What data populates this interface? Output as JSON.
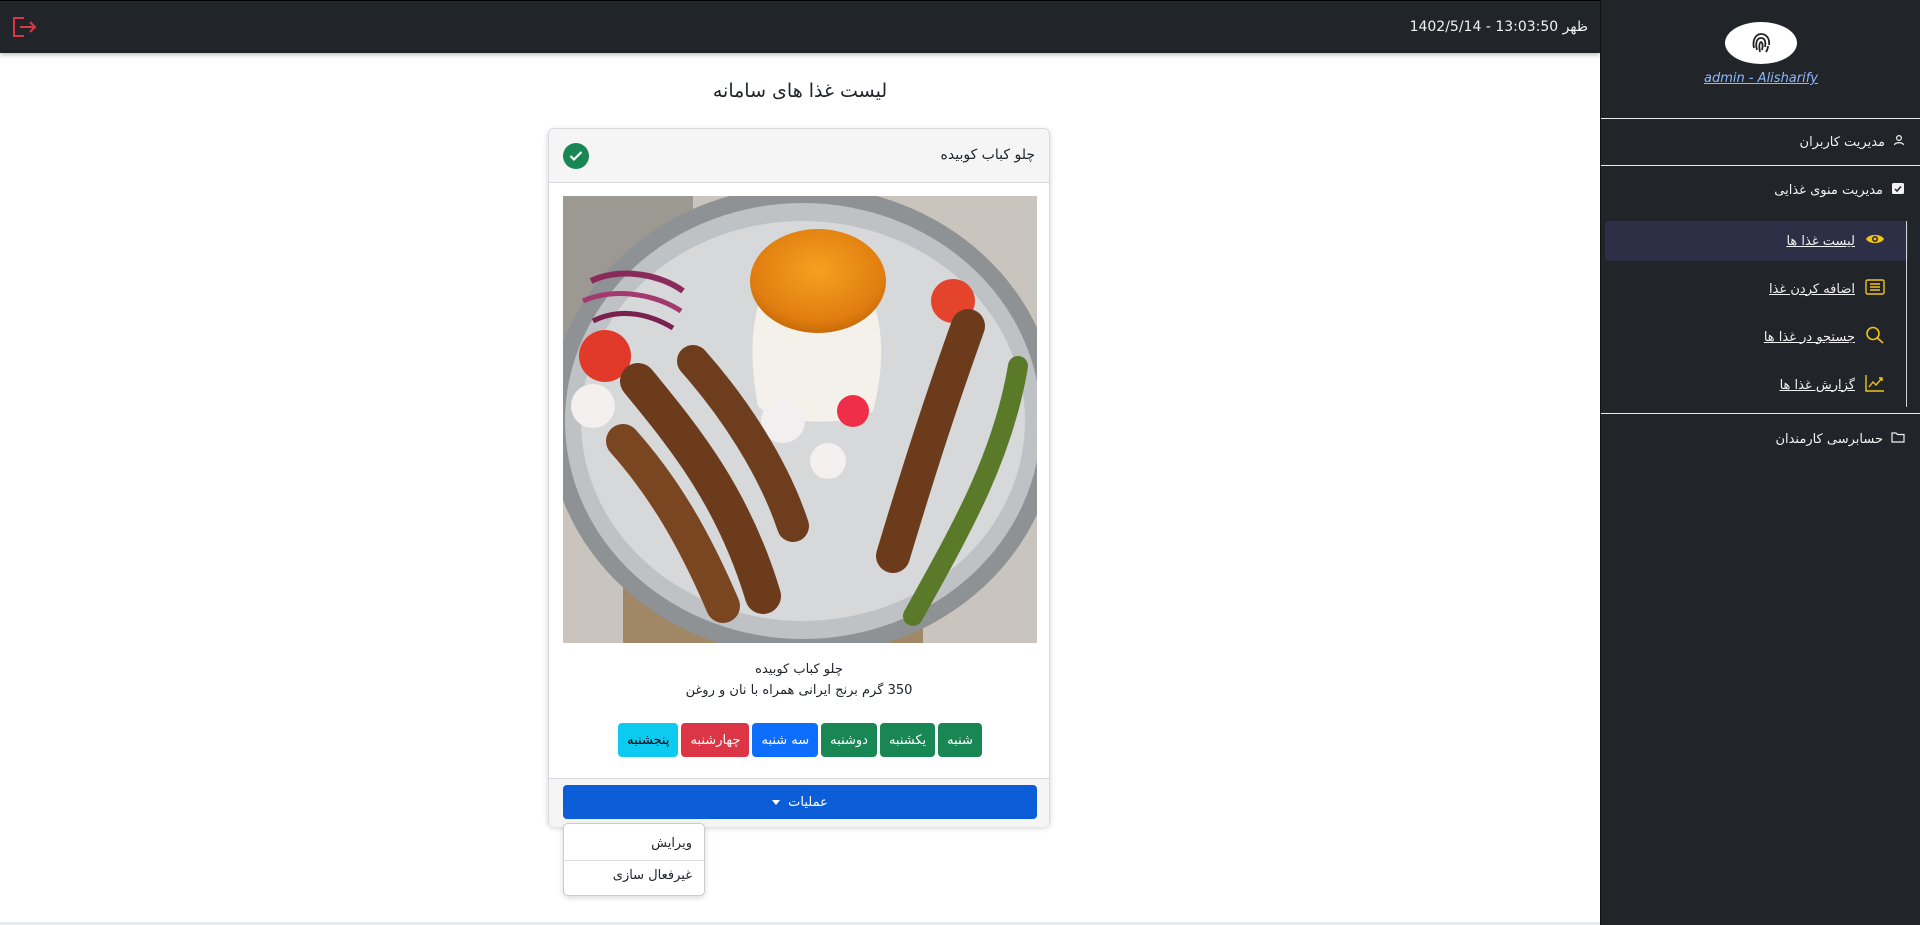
{
  "topbar": {
    "datetime": "ظهر 13:03:50 - 1402/5/14",
    "logout_color": "#dc3545"
  },
  "sidebar": {
    "username": "admin - Alisharify",
    "menu": {
      "users": "مدیریت کاربران",
      "food_menu": "مدیریت منوی غذایی",
      "employees": "حسابرسی کارمندان"
    },
    "submenu": {
      "list": "لیست غذا ها",
      "add": "اضافه کردن غذا",
      "search": "جستجو در غذا ها",
      "report": "گزارش غذا ها"
    },
    "accent": "#f0c419"
  },
  "main": {
    "page_title": "لیست غذا های سامانه",
    "card": {
      "header_title": "چلو کباب کوبیده",
      "food_name": "چلو کباب کوبیده",
      "description": "350 گرم برنج ایرانی همراه با نان و روغن",
      "days": [
        {
          "label": "شنبه",
          "color": "#198754"
        },
        {
          "label": "یکشنبه",
          "color": "#198754"
        },
        {
          "label": "دوشنبه",
          "color": "#198754"
        },
        {
          "label": "سه شنبه",
          "color": "#0d6efd"
        },
        {
          "label": "چهارشنبه",
          "color": "#dc3545"
        },
        {
          "label": "پنجشنبه",
          "color": "#0dcaf0"
        }
      ],
      "operations_label": "عملیات"
    },
    "dropdown": {
      "edit": "ویرایش",
      "deactivate": "غیرفعال سازی"
    }
  }
}
